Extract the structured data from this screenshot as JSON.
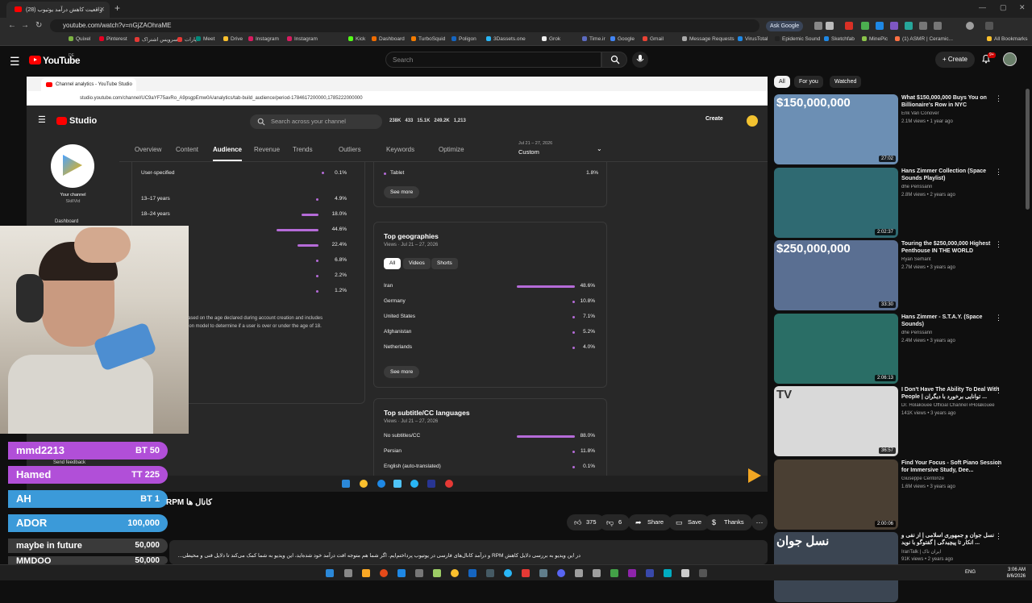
{
  "browser": {
    "tab_title": "(28) واقعیت کاهش درآمد یوتیوب",
    "url": "youtube.com/watch?v=nGjZAOhraME",
    "ask_google": "Ask Google",
    "bookmarks": [
      "Quixel",
      "Pinterest",
      "سرویس اشتراک...",
      "آپارات",
      "Meet",
      "Drive",
      "Instagram",
      "Instagram",
      "Kick",
      "Dashboard",
      "TurboSquid",
      "Poligon",
      "3Dassets.one",
      "Grok",
      "Time.ir",
      "Google",
      "Gmail",
      "Message Requests",
      "VirusTotal",
      "Epidemic Sound",
      "Sketchfab",
      "MinePic",
      "(1) ASMR | Ceramic..."
    ],
    "all_bookmarks": "All Bookmarks"
  },
  "youtube": {
    "logo": "YouTube",
    "country": "DE",
    "search_placeholder": "Search",
    "create": "Create",
    "notifications": "9+"
  },
  "inner_browser": {
    "tab_title": "Channel analytics - YouTube Studio",
    "url": "studio.youtube.com/channel/UC9aYF75avRo_A9psgpEmw0A/analytics/tab-build_audience/period-1784617200000,1785222000000"
  },
  "studio": {
    "logo": "Studio",
    "search_placeholder": "Search across your channel",
    "stats": [
      "238K",
      "433",
      "15.1K",
      "249.2K",
      "1,213"
    ],
    "create": "Create",
    "channel_label": "Your channel",
    "channel_name": "SkillVid",
    "dashboard": "Dashboard",
    "tabs": [
      "Overview",
      "Content",
      "Audience",
      "Revenue",
      "Trends",
      "Outliers",
      "Keywords",
      "Optimize"
    ],
    "active_tab": "Audience",
    "date_small": "Jul 21 – 27, 2026",
    "date_label": "Custom",
    "age": {
      "user_specified_label": "User-specified",
      "user_specified_pct": "0.1%",
      "rows": [
        {
          "label": "13–17 years",
          "pct": "4.9%",
          "value": 4.9
        },
        {
          "label": "18–24 years",
          "pct": "18.0%",
          "value": 18.0
        },
        {
          "label": "",
          "pct": "44.6%",
          "value": 44.6
        },
        {
          "label": "",
          "pct": "22.4%",
          "value": 22.4
        },
        {
          "label": "",
          "pct": "6.8%",
          "value": 6.8
        },
        {
          "label": "",
          "pct": "2.2%",
          "value": 2.2
        },
        {
          "label": "",
          "pct": "1.2%",
          "value": 1.2
        }
      ],
      "note_line1": "ased on the age declared during account creation and includes",
      "note_line2": "ion model to determine if a user is over or under the age of 18.",
      "send_feedback": "Send feedback"
    },
    "devices": {
      "tablet_label": "Tablet",
      "tablet_pct": "1.8%",
      "see_more": "See more"
    },
    "geographies": {
      "title": "Top geographies",
      "subtitle": "Views · Jul 21 – 27, 2026",
      "chips": [
        "All",
        "Videos",
        "Shorts"
      ],
      "active_chip": "All",
      "rows": [
        {
          "label": "Iran",
          "pct": "48.6%",
          "value": 48.6
        },
        {
          "label": "Germany",
          "pct": "10.8%",
          "value": 10.8
        },
        {
          "label": "United States",
          "pct": "7.1%",
          "value": 7.1
        },
        {
          "label": "Afghanistan",
          "pct": "5.2%",
          "value": 5.2
        },
        {
          "label": "Netherlands",
          "pct": "4.0%",
          "value": 4.0
        }
      ],
      "see_more": "See more"
    },
    "subtitles": {
      "title": "Top subtitle/CC languages",
      "subtitle": "Views · Jul 21 – 27, 2026",
      "rows": [
        {
          "label": "No subtitles/CC",
          "pct": "88.0%",
          "value": 88.0
        },
        {
          "label": "Persian",
          "pct": "11.8%",
          "value": 11.8
        },
        {
          "label": "English (auto-translated)",
          "pct": "0.1%",
          "value": 0.1
        }
      ]
    }
  },
  "donations": [
    {
      "name": "mmd2213",
      "amount": "BT 50",
      "color": "#b14fd8"
    },
    {
      "name": "Hamed",
      "amount": "TT 225",
      "color": "#b14fd8"
    },
    {
      "name": "AH",
      "amount": "BT 1",
      "color": "#3b9ad9"
    },
    {
      "name": "ADOR",
      "amount": "100,000",
      "color": "#3b9ad9"
    },
    {
      "name": "maybe in future",
      "amount": "50,000",
      "color": "#3a3a3a"
    },
    {
      "name": "MMDOO",
      "amount": "50,000",
      "color": "#3a3a3a"
    }
  ],
  "video": {
    "title": "RPM کانال ها",
    "likes": "375",
    "dislikes": "6",
    "share": "Share",
    "save": "Save",
    "thanks": "Thanks",
    "description": "در این ویدیو به بررسی دلایل کاهش RPM و درآمد کانال‌های فارسی در یوتیوب پرداختم‌ایم. اگر شما هم متوجه افت درآمد خود شده‌اید، این ویدیو به شما کمک می‌کند تا دلایل فنی و محیطی..."
  },
  "rail": {
    "chips": [
      "All",
      "For you",
      "Watched"
    ],
    "active_chip": "All",
    "items": [
      {
        "title": "What $150,000,000 Buys You on Billionaire's Row in NYC",
        "channel": "Erik Van Conover",
        "meta": "2.1M views • 1 year ago",
        "duration": "27:02",
        "thumb_text": "$150,000,000",
        "color": "#6c8fb4"
      },
      {
        "title": "Hans Zimmer Collection (Space Sounds Playlist)",
        "channel": "dhe Perissann",
        "meta": "2.8M views • 2 years ago",
        "duration": "2:02:37",
        "thumb_text": "",
        "color": "#2f6a72"
      },
      {
        "title": "Touring the $250,000,000 Highest Penthouse IN THE WORLD",
        "channel": "Ryan Serhant",
        "meta": "2.7M views • 3 years ago",
        "duration": "33:30",
        "thumb_text": "$250,000,000",
        "color": "#5a6f92"
      },
      {
        "title": "Hans Zimmer - S.T.A.Y. (Space Sounds)",
        "channel": "dhe Perissann",
        "meta": "2.4M views • 3 years ago",
        "duration": "2:06:13",
        "thumb_text": "",
        "color": "#2a6e66"
      },
      {
        "title": "I Don't Have The Ability To Deal With People | توانایی برخورد با دیگران ...",
        "channel": "Dr. Holakouee Official Channel #Holakouee",
        "meta": "141K views • 3 years ago",
        "duration": "36:57",
        "thumb_text": "TV",
        "color": "#d9d9d9"
      },
      {
        "title": "Find Your Focus - Soft Piano Session for Immersive Study, Dee...",
        "channel": "Giuseppe Centonze",
        "meta": "1.6M views • 3 years ago",
        "duration": "2:00:06",
        "thumb_text": "",
        "color": "#4a3f33"
      },
      {
        "title": "نسل جوان و جمهوری اسلامی | از نفی و انکار تا پیچیدگی | گفتوگو با نوید ...",
        "channel": "IranTalk | ایران تاک",
        "meta": "91K views • 2 years ago",
        "duration": "",
        "thumb_text": "نسل جوان",
        "color": "#3b4552"
      }
    ]
  },
  "taskbar": {
    "lang": "ENG",
    "time": "3:06 AM",
    "date": "8/6/2026"
  }
}
